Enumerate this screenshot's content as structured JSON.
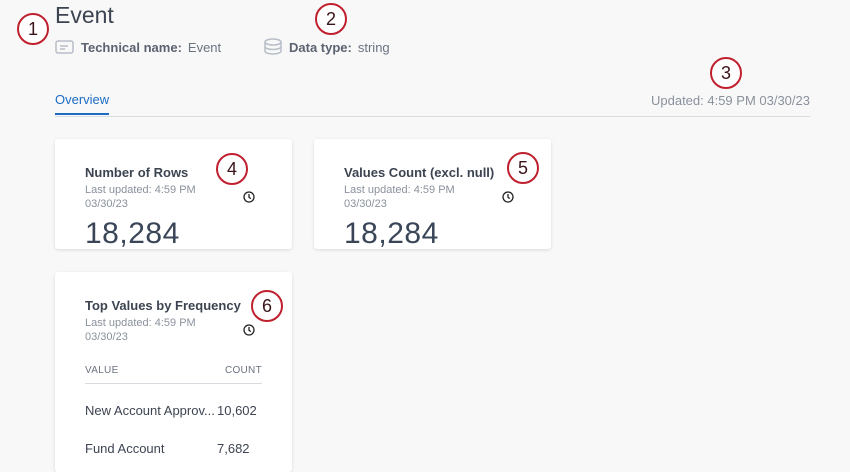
{
  "header": {
    "title": "Event",
    "technical_name_label": "Technical name:",
    "technical_name_value": "Event",
    "data_type_label": "Data type:",
    "data_type_value": "string",
    "updated": "Updated: 4:59 PM 03/30/23"
  },
  "tabs": [
    {
      "label": "Overview",
      "active": true
    }
  ],
  "cards": {
    "rows": {
      "title": "Number of Rows",
      "subtitle": "Last updated: 4:59 PM 03/30/23",
      "value": "18,284"
    },
    "values_count": {
      "title": "Values Count (excl. null)",
      "subtitle": "Last updated: 4:59 PM 03/30/23",
      "value": "18,284"
    },
    "top_values": {
      "title": "Top Values by Frequency",
      "subtitle": "Last updated: 4:59 PM 03/30/23",
      "columns": [
        "VALUE",
        "COUNT"
      ],
      "rows": [
        {
          "value": "New Account Approv...",
          "count": "10,602"
        },
        {
          "value": "Fund Account",
          "count": "7,682"
        }
      ]
    }
  },
  "annotations": [
    "1",
    "2",
    "3",
    "4",
    "5",
    "6"
  ],
  "colors": {
    "accent": "#1d6cc4",
    "badge_border": "#c0202e",
    "background": "#f8f8f9"
  }
}
